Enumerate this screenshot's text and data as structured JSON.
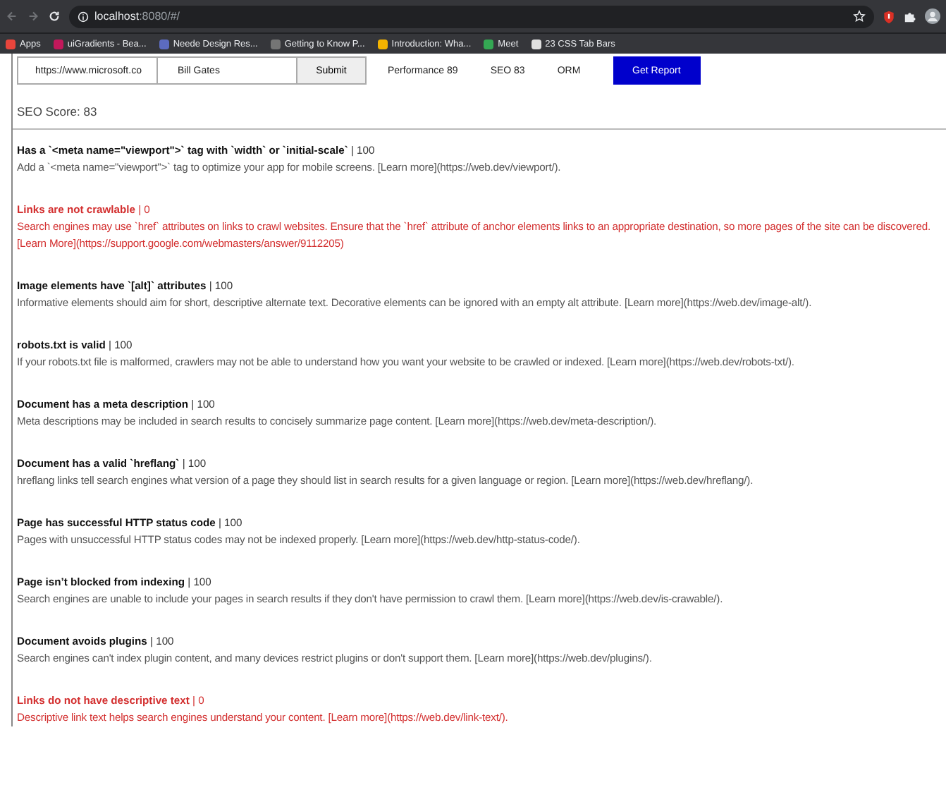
{
  "browser": {
    "url_host": "localhost",
    "url_rest": ":8080/#/",
    "bookmarks": [
      {
        "label": "Apps",
        "color": "#e8453c"
      },
      {
        "label": "uiGradients - Bea...",
        "color": "#c2185b"
      },
      {
        "label": "Neede Design Res...",
        "color": "#5c6bc0"
      },
      {
        "label": "Getting to Know P...",
        "color": "#757575"
      },
      {
        "label": "Introduction: Wha...",
        "color": "#f4b400"
      },
      {
        "label": "Meet",
        "color": "#34a853"
      },
      {
        "label": "23 CSS Tab Bars",
        "color": "#e0e0e0"
      }
    ]
  },
  "form": {
    "url_value": "https://www.microsoft.co",
    "name_value": "Bill Gates",
    "submit": "Submit",
    "scores": [
      "Performance 89",
      "SEO 83",
      "ORM"
    ],
    "report": "Get Report"
  },
  "seo_score": "SEO Score: 83",
  "audits": [
    {
      "title": "Has a `<meta name=\"viewport\">` tag with `width` or `initial-scale`",
      "score": "| 100",
      "passed": true,
      "description": "Add a `<meta name=\"viewport\">` tag to optimize your app for mobile screens. [Learn more](https://web.dev/viewport/)."
    },
    {
      "title": "Links are not crawlable",
      "score": "| 0",
      "passed": false,
      "description": "Search engines may use `href` attributes on links to crawl websites. Ensure that the `href` attribute of anchor elements links to an appropriate destination, so more pages of the site can be discovered. [Learn More](https://support.google.com/webmasters/answer/9112205)"
    },
    {
      "title": "Image elements have `[alt]` attributes",
      "score": "| 100",
      "passed": true,
      "description": "Informative elements should aim for short, descriptive alternate text. Decorative elements can be ignored with an empty alt attribute. [Learn more](https://web.dev/image-alt/)."
    },
    {
      "title": "robots.txt is valid",
      "score": "| 100",
      "passed": true,
      "description": "If your robots.txt file is malformed, crawlers may not be able to understand how you want your website to be crawled or indexed. [Learn more](https://web.dev/robots-txt/)."
    },
    {
      "title": "Document has a meta description",
      "score": "| 100",
      "passed": true,
      "description": "Meta descriptions may be included in search results to concisely summarize page content. [Learn more](https://web.dev/meta-description/)."
    },
    {
      "title": "Document has a valid `hreflang`",
      "score": "| 100",
      "passed": true,
      "description": "hreflang links tell search engines what version of a page they should list in search results for a given language or region. [Learn more](https://web.dev/hreflang/)."
    },
    {
      "title": "Page has successful HTTP status code",
      "score": "| 100",
      "passed": true,
      "description": "Pages with unsuccessful HTTP status codes may not be indexed properly. [Learn more](https://web.dev/http-status-code/)."
    },
    {
      "title": "Page isn’t blocked from indexing",
      "score": "| 100",
      "passed": true,
      "description": "Search engines are unable to include your pages in search results if they don't have permission to crawl them. [Learn more](https://web.dev/is-crawable/)."
    },
    {
      "title": "Document avoids plugins",
      "score": "| 100",
      "passed": true,
      "description": "Search engines can't index plugin content, and many devices restrict plugins or don't support them. [Learn more](https://web.dev/plugins/)."
    },
    {
      "title": "Links do not have descriptive text",
      "score": "| 0",
      "passed": false,
      "description": "Descriptive link text helps search engines understand your content. [Learn more](https://web.dev/link-text/)."
    }
  ]
}
